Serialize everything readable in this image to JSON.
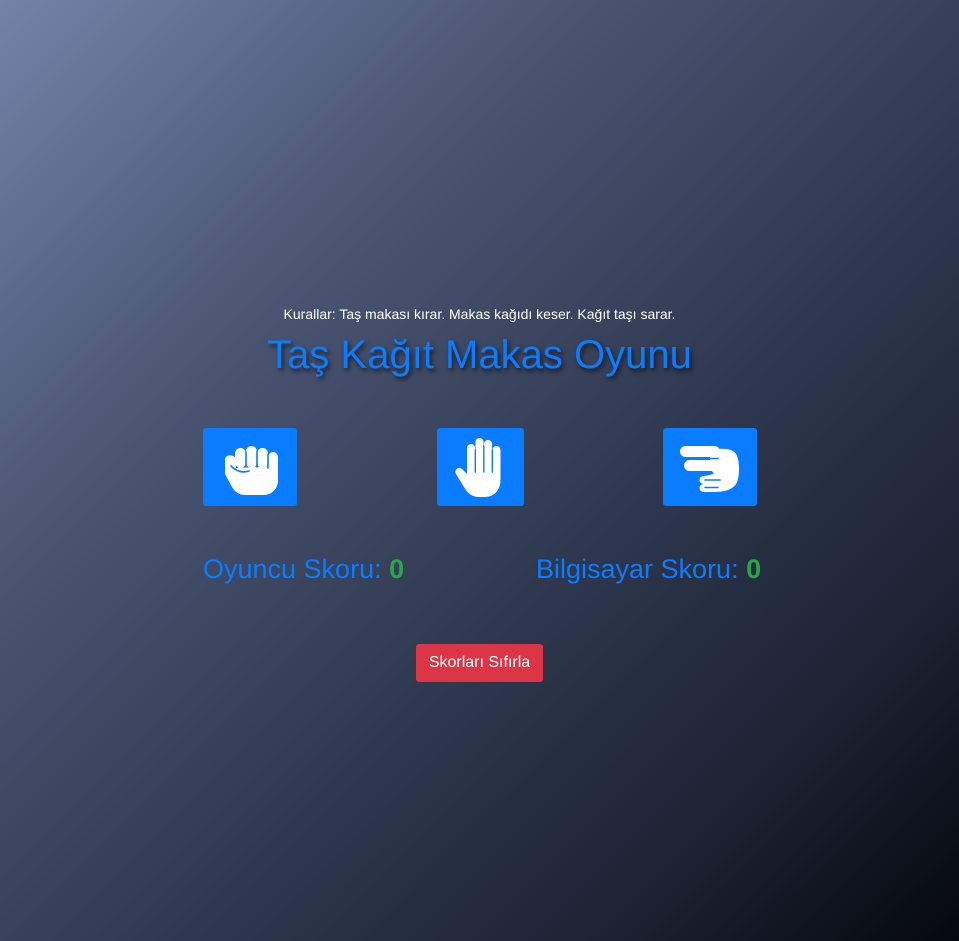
{
  "rules_text": "Kurallar: Taş makası kırar. Makas kağıdı keser. Kağıt taşı sarar.",
  "title": "Taş Kağıt Makas Oyunu",
  "choices": [
    {
      "id": "rock",
      "icon": "hand-rock-icon"
    },
    {
      "id": "paper",
      "icon": "hand-paper-icon"
    },
    {
      "id": "scissors",
      "icon": "hand-scissors-icon"
    }
  ],
  "scores": {
    "player_label": "Oyuncu Skoru:",
    "player_value": "0",
    "computer_label": "Bilgisayar Skoru:",
    "computer_value": "0"
  },
  "reset_label": "Skorları Sıfırla",
  "colors": {
    "accent": "#0a7cff",
    "score_value": "#28a745",
    "reset": "#dc3545"
  }
}
